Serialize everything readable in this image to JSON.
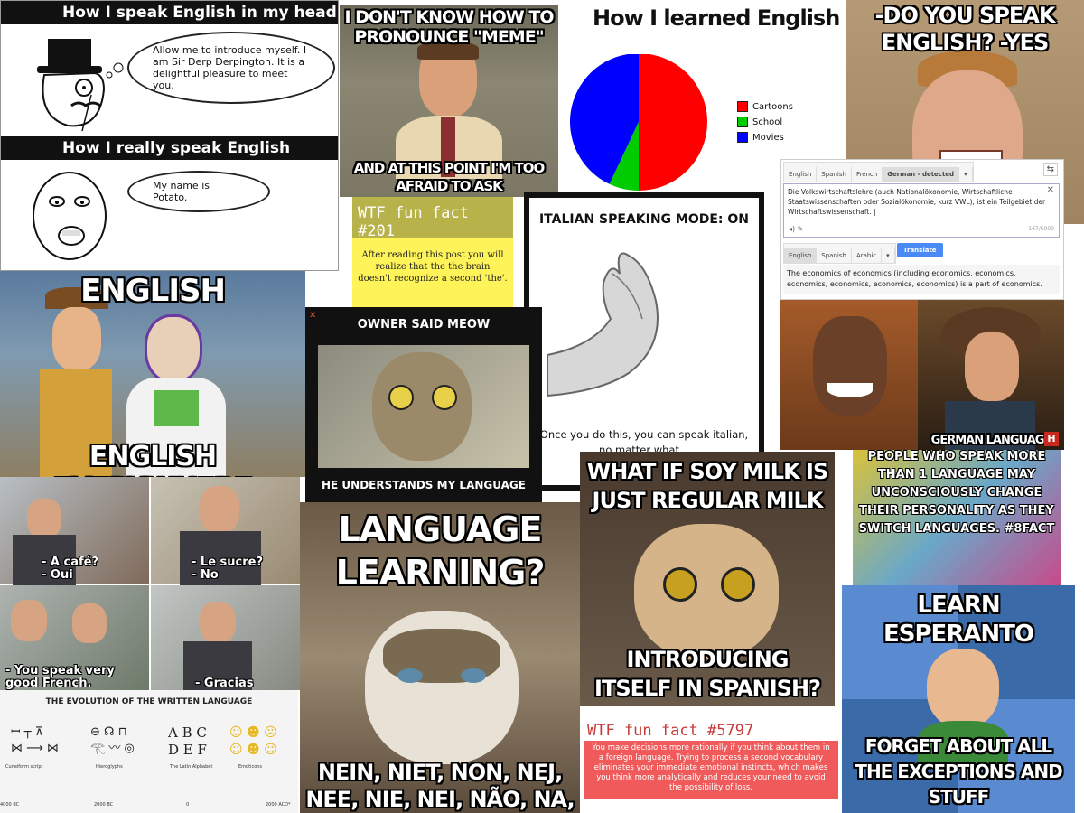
{
  "sir_derp": {
    "head_title": "How I speak English in my head",
    "bubble_1": "Allow me to introduce myself. I am Sir Derp Derpington. It is a delightful pleasure to meet you.",
    "real_title": "How I really speak English",
    "bubble_2": "My name is Potato."
  },
  "meme_pronounce": {
    "top": "I DON'T KNOW HOW TO PRONOUNCE \"MEME\"",
    "bottom": "AND AT THIS POINT I'M TOO AFRAID TO ASK"
  },
  "how_learned": {
    "title": "How I learned English",
    "chart_data": {
      "type": "pie",
      "title": "How I learned English",
      "series": [
        {
          "name": "Cartoons",
          "value": 50,
          "color": "#ff0000"
        },
        {
          "name": "School",
          "value": 7,
          "color": "#00cc00"
        },
        {
          "name": "Movies",
          "value": 43,
          "color": "#0000ff"
        }
      ],
      "legend_placement": "right"
    }
  },
  "do_you_speak": {
    "top": "-DO YOU SPEAK ENGLISH? -YES"
  },
  "google_translate": {
    "src_tabs": [
      "English",
      "Spanish",
      "French",
      "German - detected"
    ],
    "input_text": "Die Volkswirtschaftslehre (auch Nationalökonomie, Wirtschaftliche Staatswissenschaften oder Sozialökonomie, kurz VWL), ist ein Teilgebiet der Wirtschaftswissenschaft. |",
    "char_count": "167/5000",
    "tgt_tabs": [
      "English",
      "Spanish",
      "Arabic"
    ],
    "translate_label": "Translate",
    "output_text": "The economics of economics (including economics, economics, economics, economics, economics, economics) is a part of economics."
  },
  "wtf_201": {
    "head": "WTF fun fact #201",
    "body": "After reading this post you will realize that the the brain doesn't recognize a second 'the'."
  },
  "italian": {
    "title": "ITALIAN SPEAKING MODE: ON",
    "caption": "Once you do this, you can speak italian, no matter what..."
  },
  "toy_story": {
    "top": "ENGLISH",
    "bottom": "ENGLISH EVERYWHERE"
  },
  "cat_meow": {
    "title": "OWNER SAID MEOW",
    "bottom": "HE UNDERSTANDS MY LANGUAGE"
  },
  "xzibit": {
    "caption": "GERMAN LANGUAGE",
    "channel_badge": "H"
  },
  "bean": {
    "subs": [
      "- A café?\n- Oui",
      "- Le sucre?\n- No",
      "- You speak very good French.",
      "- Gracias"
    ]
  },
  "soy_milk": {
    "top": "WHAT IF SOY MILK IS JUST REGULAR MILK",
    "bottom": "INTRODUCING ITSELF IN SPANISH?"
  },
  "multilingual": {
    "text": "PEOPLE WHO SPEAK MORE THAN 1 LANGUAGE MAY UNCONSCIOUSLY CHANGE THEIR PERSONALITY AS THEY SWITCH LANGUAGES. #8FACT"
  },
  "grumpy": {
    "top": "LANGUAGE LEARNING?",
    "bottom": "NEIN, NIET, NON, NEJ, NEE, NIE, NEI, NÃO, NA,"
  },
  "evolution": {
    "title": "THE EVOLUTION OF THE WRITTEN LANGUAGE",
    "glyphs": [
      "ꟷ ┬ ⊼\n⋈ ⟶ ⋈",
      "⊖ ☊ ⊓\n𓂀 〰 ◎",
      "A B C\nD E F",
      "☺ ☻ ☹\n☺ ☻ ☺"
    ],
    "labels": [
      "Cuneiform script",
      "Hieroglyphs",
      "The Latin Alphabet",
      "Emoticons"
    ],
    "years": [
      "4000 BC",
      "2000 BC",
      "0",
      "2000 ACD*"
    ]
  },
  "wtf_5797": {
    "head": "WTF fun fact #5797",
    "body": "You make decisions more rationally if you think about them in a foreign language. Trying to process a second vocabulary eliminates your immediate emotional instincts, which makes you think more analytically and reduces your need to avoid the possibility of loss."
  },
  "esperanto": {
    "top": "LEARN ESPERANTO",
    "bottom": "FORGET ABOUT ALL THE EXCEPTIONS AND STUFF"
  }
}
